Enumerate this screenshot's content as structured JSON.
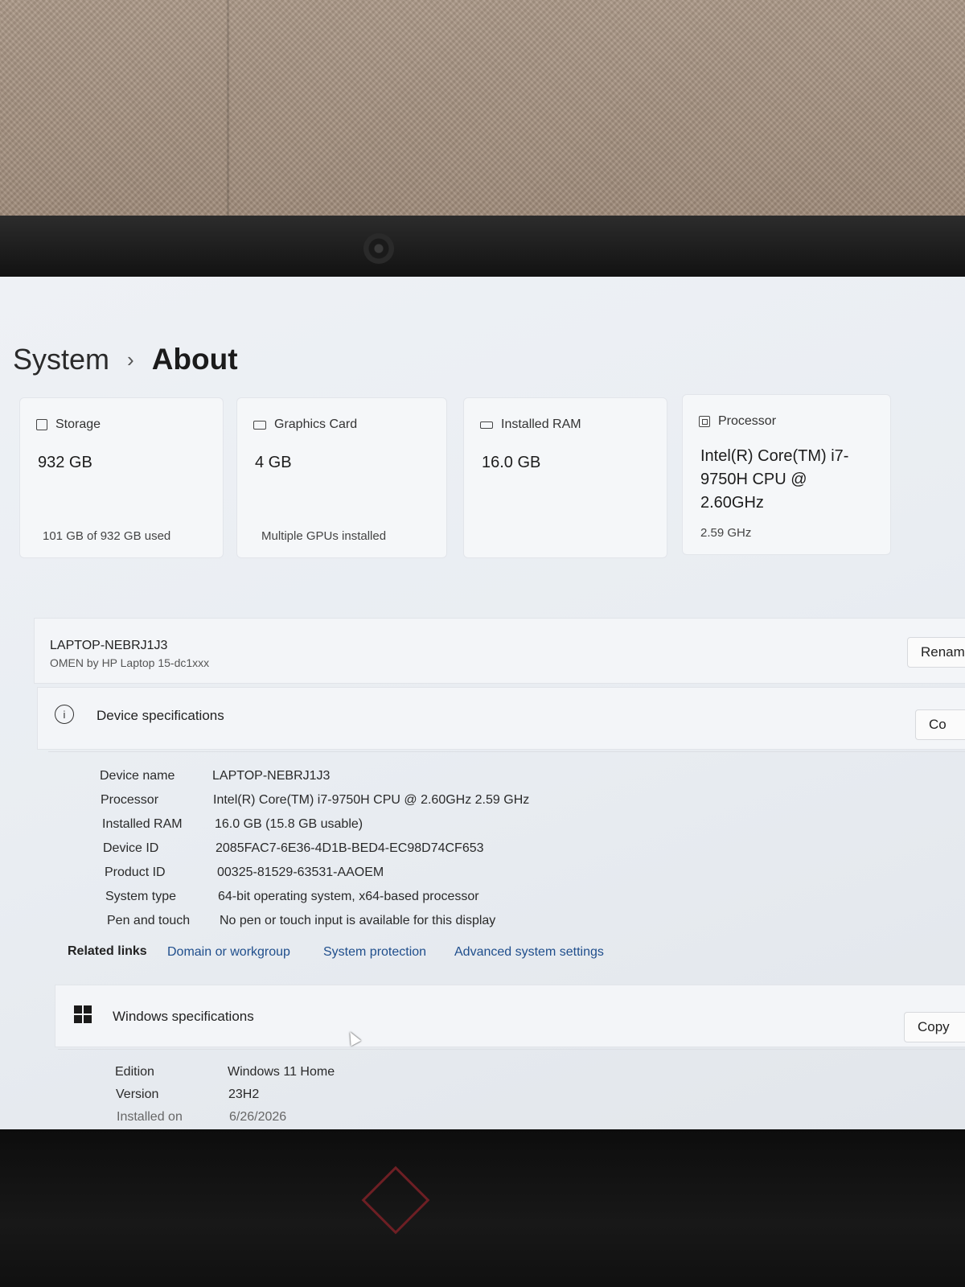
{
  "breadcrumb": {
    "root": "System",
    "separator": "›",
    "current": "About"
  },
  "cards": [
    {
      "icon": "storage-icon",
      "label": "Storage",
      "value": "932 GB",
      "sub": "101 GB of 932 GB used"
    },
    {
      "icon": "graphics-card-icon",
      "label": "Graphics Card",
      "value": "4 GB",
      "sub": "Multiple GPUs installed"
    },
    {
      "icon": "ram-icon",
      "label": "Installed RAM",
      "value": "16.0 GB",
      "sub": ""
    },
    {
      "icon": "processor-icon",
      "label": "Processor",
      "value": "Intel(R) Core(TM) i7-9750H CPU @ 2.60GHz",
      "sub": "2.59 GHz"
    }
  ],
  "device": {
    "name": "LAPTOP-NEBRJ1J3",
    "model": "OMEN by HP Laptop 15-dc1xxx",
    "rename_label": "Renam"
  },
  "device_specs": {
    "title": "Device specifications",
    "copy_label": "Co",
    "rows": [
      {
        "key": "Device name",
        "value": "LAPTOP-NEBRJ1J3"
      },
      {
        "key": "Processor",
        "value": "Intel(R) Core(TM) i7-9750H CPU @ 2.60GHz   2.59 GHz"
      },
      {
        "key": "Installed RAM",
        "value": "16.0 GB (15.8 GB usable)"
      },
      {
        "key": "Device ID",
        "value": "2085FAC7-6E36-4D1B-BED4-EC98D74CF653"
      },
      {
        "key": "Product ID",
        "value": "00325-81529-63531-AAOEM"
      },
      {
        "key": "System type",
        "value": "64-bit operating system, x64-based processor"
      },
      {
        "key": "Pen and touch",
        "value": "No pen or touch input is available for this display"
      }
    ]
  },
  "related_links": {
    "label": "Related links",
    "links": [
      "Domain or workgroup",
      "System protection",
      "Advanced system settings"
    ]
  },
  "windows_specs": {
    "title": "Windows specifications",
    "copy_label": "Copy",
    "rows": [
      {
        "key": "Edition",
        "value": "Windows 11 Home"
      },
      {
        "key": "Version",
        "value": "23H2"
      },
      {
        "key": "Installed on",
        "value": "6/26/2026"
      }
    ]
  }
}
